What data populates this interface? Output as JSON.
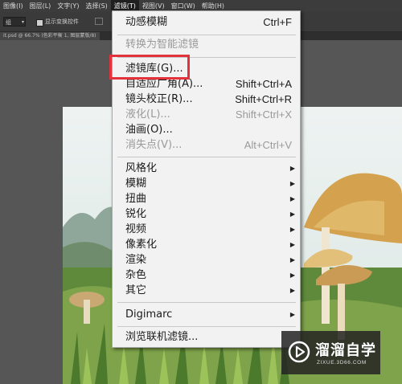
{
  "menubar": {
    "items": [
      {
        "label": "图像(I)"
      },
      {
        "label": "图层(L)"
      },
      {
        "label": "文字(Y)"
      },
      {
        "label": "选择(S)"
      },
      {
        "label": "滤镜(T)"
      },
      {
        "label": "视图(V)"
      },
      {
        "label": "窗口(W)"
      },
      {
        "label": "帮助(H)"
      }
    ],
    "active": "滤镜(T)"
  },
  "options_bar": {
    "preset_value": "组",
    "checkbox_label": "显示变换控件"
  },
  "document_tab": {
    "label": "it.psd @ 66.7% (色彩平衡 1, 图层蒙版/8)"
  },
  "filter_menu": {
    "items": [
      {
        "label": "动感模糊",
        "shortcut": "Ctrl+F",
        "disabled": false
      },
      {
        "label": "转换为智能滤镜",
        "shortcut": "",
        "disabled": true
      },
      {
        "label": "滤镜库(G)...",
        "shortcut": "",
        "disabled": false,
        "highlighted": true
      },
      {
        "label": "自适应广角(A)...",
        "shortcut": "Shift+Ctrl+A",
        "disabled": false
      },
      {
        "label": "镜头校正(R)...",
        "shortcut": "Shift+Ctrl+R",
        "disabled": false
      },
      {
        "label": "液化(L)...",
        "shortcut": "Shift+Ctrl+X",
        "disabled": true
      },
      {
        "label": "油画(O)...",
        "shortcut": "",
        "disabled": false
      },
      {
        "label": "消失点(V)...",
        "shortcut": "Alt+Ctrl+V",
        "disabled": true
      },
      {
        "label": "风格化",
        "submenu": true
      },
      {
        "label": "模糊",
        "submenu": true
      },
      {
        "label": "扭曲",
        "submenu": true
      },
      {
        "label": "锐化",
        "submenu": true
      },
      {
        "label": "视频",
        "submenu": true
      },
      {
        "label": "像素化",
        "submenu": true
      },
      {
        "label": "渲染",
        "submenu": true
      },
      {
        "label": "杂色",
        "submenu": true
      },
      {
        "label": "其它",
        "submenu": true
      },
      {
        "label": "Digimarc",
        "submenu": true
      },
      {
        "label": "浏览联机滤镜..."
      }
    ],
    "highlight_color": "#e2323c"
  },
  "watermark": {
    "title": "溜溜自学",
    "subtitle": "ZIXUE.3D66.COM"
  },
  "colors": {
    "menubar_bg": "#3c3c3c",
    "menu_bg": "#f2f2f2",
    "disabled_text": "#9a9a9a",
    "highlight_box": "#e2323c"
  }
}
